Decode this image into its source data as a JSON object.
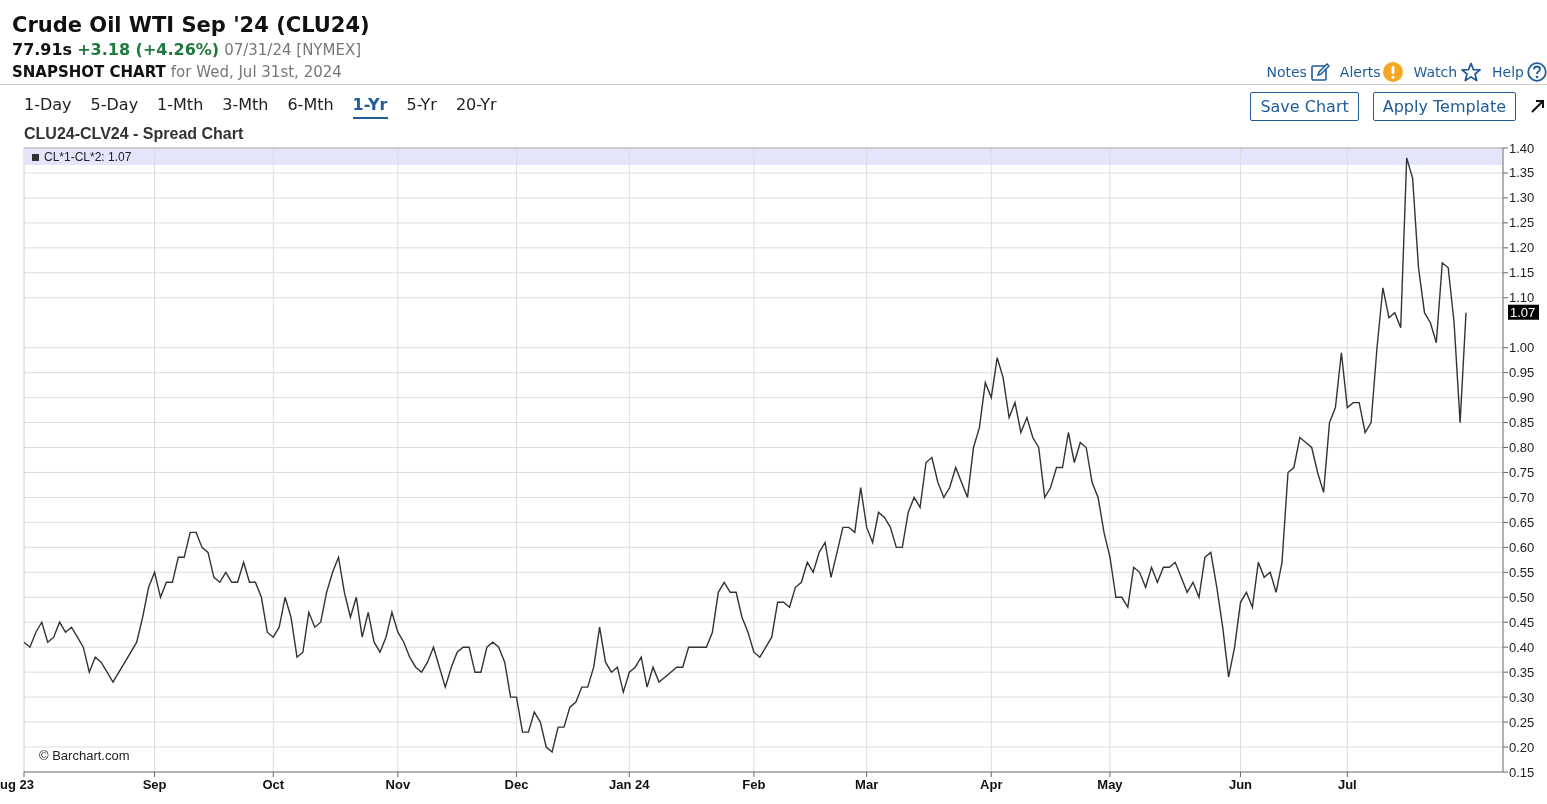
{
  "header": {
    "title": "Crude Oil WTI Sep '24 (CLU24)",
    "price": "77.91s",
    "change": "+3.18 (+4.26%)",
    "date_exchange": "07/31/24 [NYMEX]",
    "snapshot_label": "SNAPSHOT CHART",
    "snapshot_date": "for Wed, Jul 31st, 2024"
  },
  "links": [
    {
      "label": "Notes",
      "kind": "notes"
    },
    {
      "label": "Alerts",
      "kind": "alerts"
    },
    {
      "label": "Watch",
      "kind": "watch"
    },
    {
      "label": "Help",
      "kind": "help"
    }
  ],
  "range_tabs": [
    {
      "label": "1-Day",
      "selected": false
    },
    {
      "label": "5-Day",
      "selected": false
    },
    {
      "label": "1-Mth",
      "selected": false
    },
    {
      "label": "3-Mth",
      "selected": false
    },
    {
      "label": "6-Mth",
      "selected": false
    },
    {
      "label": "1-Yr",
      "selected": true
    },
    {
      "label": "5-Yr",
      "selected": false
    },
    {
      "label": "20-Yr",
      "selected": false
    }
  ],
  "buttons": [
    {
      "label": "Save Chart"
    },
    {
      "label": "Apply Template"
    }
  ],
  "chart": {
    "title": "CLU24-CLV24 - Spread Chart",
    "legend_value": ": 1.07",
    "last_value": "1.07",
    "credit": "© Barchart.com",
    "chart_data": {
      "type": "line",
      "grid": true,
      "ylim": [
        0.15,
        1.4
      ],
      "yticks": [
        {
          "value": 0.15,
          "label": "0.15"
        },
        {
          "value": 0.2,
          "label": "0.20"
        },
        {
          "value": 0.25,
          "label": "0.25"
        },
        {
          "value": 0.3,
          "label": "0.30"
        },
        {
          "value": 0.35,
          "label": "0.35"
        },
        {
          "value": 0.4,
          "label": "0.40"
        },
        {
          "value": 0.45,
          "label": "0.45"
        },
        {
          "value": 0.5,
          "label": "0.50"
        },
        {
          "value": 0.55,
          "label": "0.55"
        },
        {
          "value": 0.6,
          "label": "0.60"
        },
        {
          "value": 0.65,
          "label": "0.65"
        },
        {
          "value": 0.7,
          "label": "0.70"
        },
        {
          "value": 0.75,
          "label": "0.75"
        },
        {
          "value": 0.8,
          "label": "0.80"
        },
        {
          "value": 0.85,
          "label": "0.85"
        },
        {
          "value": 0.9,
          "label": "0.90"
        },
        {
          "value": 0.95,
          "label": "0.95"
        },
        {
          "value": 1.0,
          "label": "1.00"
        },
        {
          "value": 1.1,
          "label": "1.10"
        },
        {
          "value": 1.15,
          "label": "1.15"
        },
        {
          "value": 1.2,
          "label": "1.20"
        },
        {
          "value": 1.25,
          "label": "1.25"
        },
        {
          "value": 1.3,
          "label": "1.30"
        },
        {
          "value": 1.35,
          "label": "1.35"
        },
        {
          "value": 1.4,
          "label": "1.40"
        }
      ],
      "categories": [
        "ug 23",
        null,
        null,
        null,
        null,
        null,
        null,
        null,
        null,
        null,
        null,
        null,
        null,
        null,
        null,
        null,
        null,
        null,
        null,
        null,
        null,
        null,
        "Sep",
        null,
        null,
        null,
        null,
        null,
        null,
        null,
        null,
        null,
        null,
        null,
        null,
        null,
        null,
        null,
        null,
        null,
        null,
        null,
        "Oct",
        null,
        null,
        null,
        null,
        null,
        null,
        null,
        null,
        null,
        null,
        null,
        null,
        null,
        null,
        null,
        null,
        null,
        null,
        null,
        null,
        "Nov",
        null,
        null,
        null,
        null,
        null,
        null,
        null,
        null,
        null,
        null,
        null,
        null,
        null,
        null,
        null,
        null,
        null,
        null,
        null,
        "Dec",
        null,
        null,
        null,
        null,
        null,
        null,
        null,
        null,
        null,
        null,
        null,
        null,
        null,
        null,
        null,
        null,
        null,
        null,
        "Jan 24",
        null,
        null,
        null,
        null,
        null,
        null,
        null,
        null,
        null,
        null,
        null,
        null,
        null,
        null,
        null,
        null,
        null,
        null,
        null,
        null,
        "Feb",
        null,
        null,
        null,
        null,
        null,
        null,
        null,
        null,
        null,
        null,
        null,
        null,
        null,
        null,
        null,
        null,
        null,
        null,
        "Mar",
        null,
        null,
        null,
        null,
        null,
        null,
        null,
        null,
        null,
        null,
        null,
        null,
        null,
        null,
        null,
        null,
        null,
        null,
        null,
        null,
        "Apr",
        null,
        null,
        null,
        null,
        null,
        null,
        null,
        null,
        null,
        null,
        null,
        null,
        null,
        null,
        null,
        null,
        null,
        null,
        null,
        "May",
        null,
        null,
        null,
        null,
        null,
        null,
        null,
        null,
        null,
        null,
        null,
        null,
        null,
        null,
        null,
        null,
        null,
        null,
        null,
        null,
        null,
        "Jun",
        null,
        null,
        null,
        null,
        null,
        null,
        null,
        null,
        null,
        null,
        null,
        null,
        null,
        null,
        null,
        null,
        null,
        "Jul",
        null,
        null,
        null,
        null,
        null,
        null,
        null,
        null,
        null,
        null,
        null,
        null,
        null,
        null,
        null,
        null,
        null,
        null,
        null,
        null
      ],
      "series": [
        {
          "name": "CL*1-CL*2",
          "color": "#333333",
          "values": [
            0.41,
            0.4,
            0.43,
            0.45,
            0.41,
            0.42,
            0.45,
            0.43,
            0.44,
            0.42,
            0.4,
            0.35,
            0.38,
            0.37,
            0.35,
            0.33,
            0.35,
            0.37,
            0.39,
            0.41,
            0.46,
            0.52,
            0.55,
            0.5,
            0.53,
            0.53,
            0.58,
            0.58,
            0.63,
            0.63,
            0.6,
            0.59,
            0.54,
            0.53,
            0.55,
            0.53,
            0.53,
            0.57,
            0.53,
            0.53,
            0.5,
            0.43,
            0.42,
            0.44,
            0.5,
            0.46,
            0.38,
            0.39,
            0.47,
            0.44,
            0.45,
            0.51,
            0.55,
            0.58,
            0.51,
            0.46,
            0.5,
            0.42,
            0.47,
            0.41,
            0.39,
            0.42,
            0.47,
            0.43,
            0.41,
            0.38,
            0.36,
            0.35,
            0.37,
            0.4,
            0.36,
            0.32,
            0.36,
            0.39,
            0.4,
            0.4,
            0.35,
            0.35,
            0.4,
            0.41,
            0.4,
            0.37,
            0.3,
            0.3,
            0.23,
            0.23,
            0.27,
            0.25,
            0.2,
            0.19,
            0.24,
            0.24,
            0.28,
            0.29,
            0.32,
            0.32,
            0.36,
            0.44,
            0.37,
            0.35,
            0.36,
            0.31,
            0.35,
            0.36,
            0.38,
            0.32,
            0.36,
            0.33,
            0.34,
            0.35,
            0.36,
            0.36,
            0.4,
            0.4,
            0.4,
            0.4,
            0.43,
            0.51,
            0.53,
            0.51,
            0.51,
            0.46,
            0.43,
            0.39,
            0.38,
            0.4,
            0.42,
            0.49,
            0.49,
            0.48,
            0.52,
            0.53,
            0.57,
            0.55,
            0.59,
            0.61,
            0.54,
            0.59,
            0.64,
            0.64,
            0.63,
            0.72,
            0.64,
            0.61,
            0.67,
            0.66,
            0.64,
            0.6,
            0.6,
            0.67,
            0.7,
            0.68,
            0.77,
            0.78,
            0.73,
            0.7,
            0.72,
            0.76,
            0.73,
            0.7,
            0.8,
            0.84,
            0.93,
            0.9,
            0.98,
            0.94,
            0.86,
            0.89,
            0.83,
            0.86,
            0.82,
            0.8,
            0.7,
            0.72,
            0.76,
            0.76,
            0.83,
            0.77,
            0.81,
            0.8,
            0.73,
            0.7,
            0.63,
            0.58,
            0.5,
            0.5,
            0.48,
            0.56,
            0.55,
            0.52,
            0.56,
            0.53,
            0.56,
            0.56,
            0.57,
            0.54,
            0.51,
            0.53,
            0.5,
            0.58,
            0.59,
            0.52,
            0.44,
            0.34,
            0.4,
            0.49,
            0.51,
            0.48,
            0.57,
            0.54,
            0.55,
            0.51,
            0.57,
            0.75,
            0.76,
            0.82,
            0.81,
            0.8,
            0.75,
            0.71,
            0.85,
            0.88,
            0.99,
            0.88,
            0.89,
            0.89,
            0.83,
            0.85,
            1.0,
            1.12,
            1.06,
            1.07,
            1.04,
            1.38,
            1.34,
            1.16,
            1.07,
            1.05,
            1.01,
            1.17,
            1.16,
            1.05,
            0.85,
            1.07
          ]
        }
      ]
    }
  }
}
